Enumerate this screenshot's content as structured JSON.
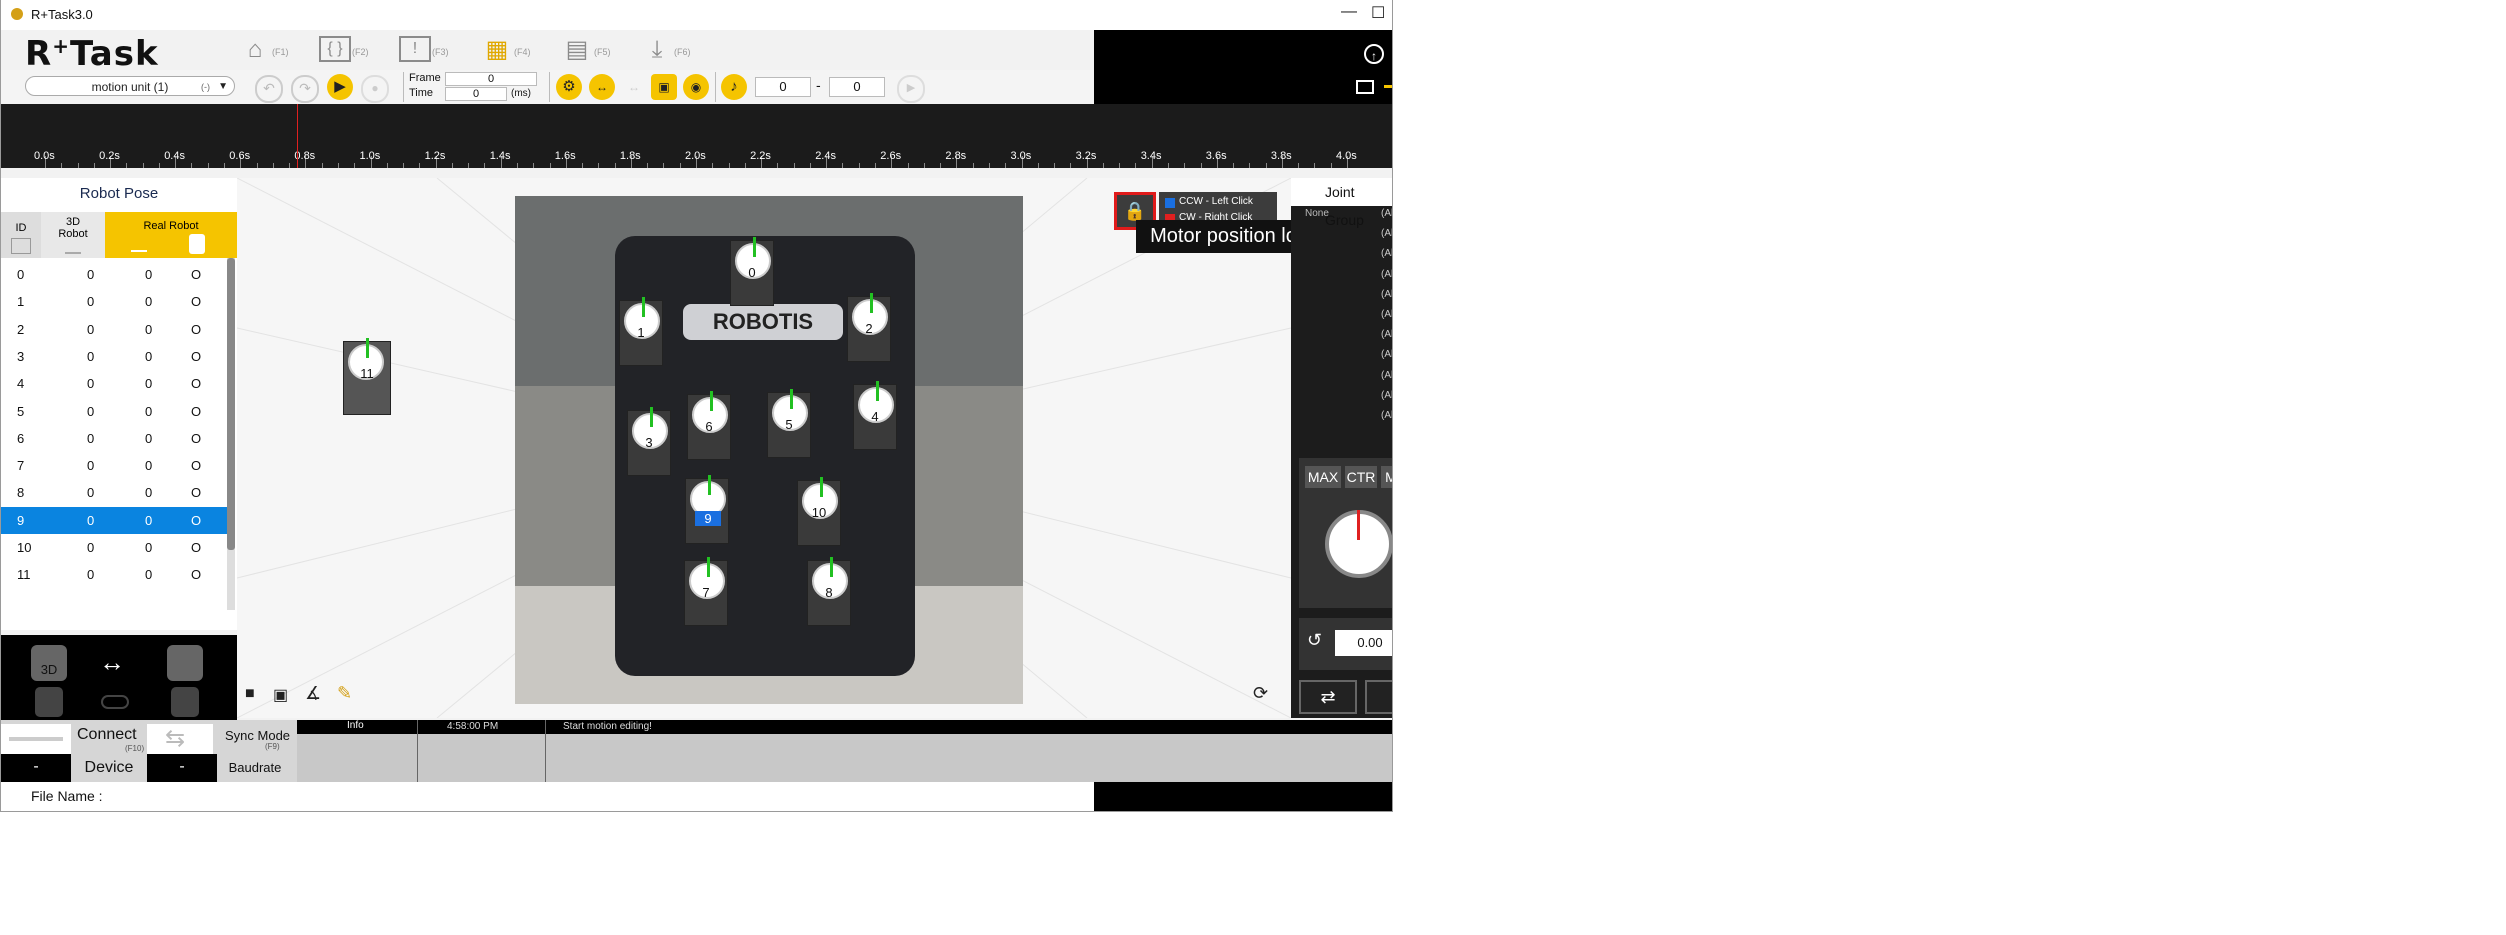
{
  "window": {
    "title": "R+Task3.0",
    "minimize_label": "—",
    "maximize_label": "☐"
  },
  "app": {
    "logo_r": "R",
    "logo_plus": "+",
    "logo_task": "Task"
  },
  "top_menu": [
    {
      "icon": "home-icon",
      "glyph": "⌂",
      "fkey": "(F1)"
    },
    {
      "icon": "code-icon",
      "glyph": "{ }",
      "fkey": "(F2)"
    },
    {
      "icon": "alert-screen-icon",
      "glyph": "!",
      "fkey": "(F3)"
    },
    {
      "icon": "film-icon",
      "glyph": "▦",
      "fkey": "(F4)"
    },
    {
      "icon": "clapper-icon",
      "glyph": "▤",
      "fkey": "(F5)"
    },
    {
      "icon": "download-icon",
      "glyph": "⤓",
      "fkey": "(F6)"
    }
  ],
  "toolbar": {
    "motion_unit": "motion unit (1)",
    "motion_unit_suffix": "(-)",
    "frame_label": "Frame",
    "frame_value": "0",
    "time_label": "Time",
    "time_value": "0",
    "time_unit": "(ms)",
    "range_start": "0",
    "range_sep": "-",
    "range_end": "0"
  },
  "timeline": {
    "labels": [
      "0.0s",
      "0.2s",
      "0.4s",
      "0.6s",
      "0.8s",
      "1.0s",
      "1.2s",
      "1.4s",
      "1.6s",
      "1.8s",
      "2.0s",
      "2.2s",
      "2.4s",
      "2.6s",
      "2.8s",
      "3.0s",
      "3.2s",
      "3.4s",
      "3.6s",
      "3.8s",
      "4.0s"
    ]
  },
  "robot_pose": {
    "title": "Robot Pose",
    "col_id": "ID",
    "col_3d_robot": "3D\nRobot",
    "col_real_robot": "Real Robot",
    "rows": [
      {
        "id": "0",
        "a": "0",
        "b": "0",
        "c": "O"
      },
      {
        "id": "1",
        "a": "0",
        "b": "0",
        "c": "O"
      },
      {
        "id": "2",
        "a": "0",
        "b": "0",
        "c": "O"
      },
      {
        "id": "3",
        "a": "0",
        "b": "0",
        "c": "O"
      },
      {
        "id": "4",
        "a": "0",
        "b": "0",
        "c": "O"
      },
      {
        "id": "5",
        "a": "0",
        "b": "0",
        "c": "O"
      },
      {
        "id": "6",
        "a": "0",
        "b": "0",
        "c": "O"
      },
      {
        "id": "7",
        "a": "0",
        "b": "0",
        "c": "O"
      },
      {
        "id": "8",
        "a": "0",
        "b": "0",
        "c": "O"
      },
      {
        "id": "9",
        "a": "0",
        "b": "0",
        "c": "O"
      },
      {
        "id": "10",
        "a": "0",
        "b": "0",
        "c": "O"
      },
      {
        "id": "11",
        "a": "0",
        "b": "0",
        "c": "O"
      }
    ],
    "selected_row": "9"
  },
  "left_icons": {
    "label_3d": "3D"
  },
  "viewer": {
    "photo_logo": "ROBOTIS",
    "floating_motor": "11",
    "motors": [
      {
        "id": "0"
      },
      {
        "id": "1"
      },
      {
        "id": "2"
      },
      {
        "id": "3"
      },
      {
        "id": "4"
      },
      {
        "id": "5"
      },
      {
        "id": "6"
      },
      {
        "id": "9"
      },
      {
        "id": "10"
      },
      {
        "id": "7"
      },
      {
        "id": "8"
      }
    ],
    "lock_tooltip": "Motor position lock",
    "legend_ccw": "CCW  - Left Click",
    "legend_cw": "CW   - Right Click"
  },
  "joint_group": {
    "title": "Joint Group",
    "none_label": "None",
    "items": [
      "(All)",
      "(All)",
      "(All)",
      "(All)",
      "(All)",
      "(All)",
      "(All)",
      "(All)",
      "(All)",
      "(All)",
      "(All)"
    ],
    "btn_max": "MAX",
    "btn_ctr": "CTR",
    "btn_n": "M",
    "value": "0.00"
  },
  "bottom": {
    "connect": "Connect",
    "connect_fkey": "(F10)",
    "sync_mode": "Sync Mode",
    "sync_fkey": "(F9)",
    "device_label": "Device",
    "device_value": "-",
    "baudrate_label": "Baudrate",
    "baudrate_value": "-",
    "col_info": "Info",
    "log_time": "4:58:00 PM",
    "log_message": "Start motion editing!"
  },
  "file": {
    "label": "File Name :"
  }
}
